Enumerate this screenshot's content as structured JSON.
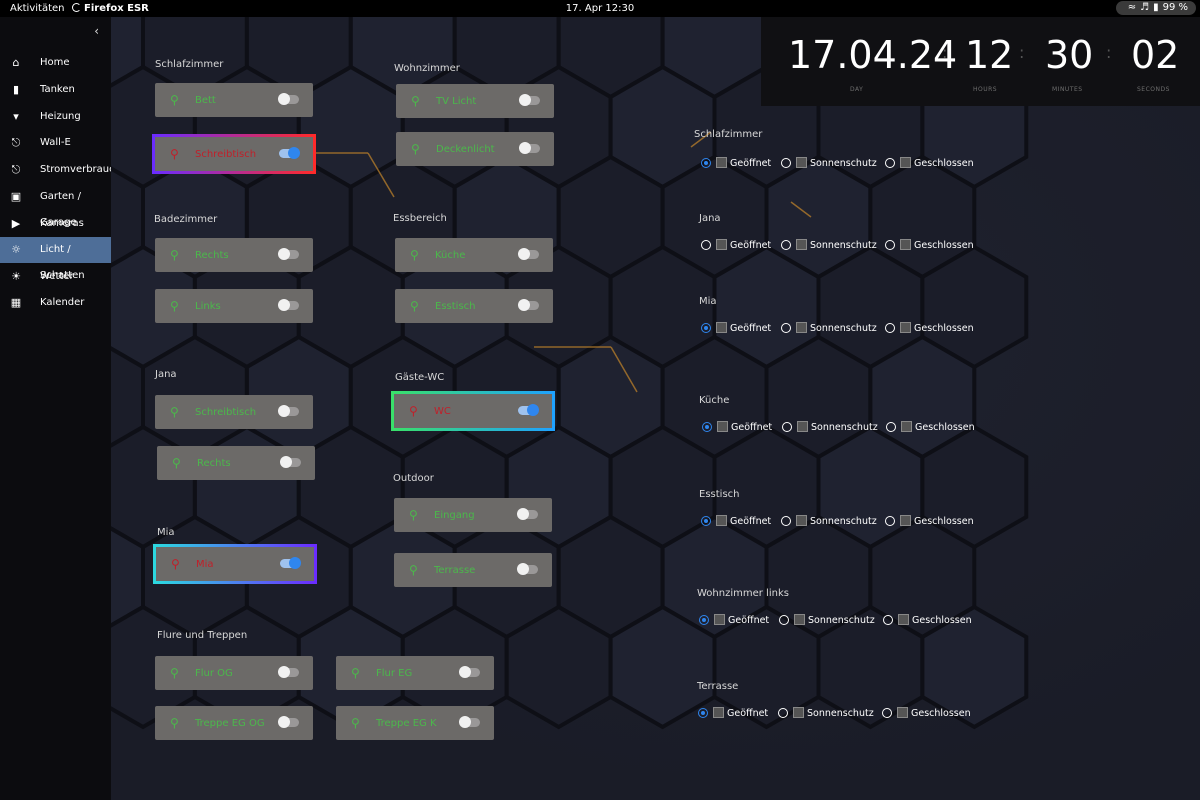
{
  "topbar": {
    "activities": "Aktivitäten",
    "app": "Firefox ESR",
    "datetime": "17. Apr  12:30",
    "battery": "99 %"
  },
  "sidebar": {
    "collapse_icon": "chevron-left-icon",
    "items": [
      {
        "label": "Home",
        "icon": "home-icon"
      },
      {
        "label": "Tanken",
        "icon": "fuel-icon"
      },
      {
        "label": "Heizung",
        "icon": "thermometer-icon"
      },
      {
        "label": "Wall-E",
        "icon": "plug-icon"
      },
      {
        "label": "Stromverbrauch",
        "icon": "power-plug-icon"
      },
      {
        "label": "Garten / Garage",
        "icon": "garage-icon"
      },
      {
        "label": "Kameras",
        "icon": "camera-icon"
      },
      {
        "label": "Licht / Schatten",
        "icon": "lamp-icon"
      },
      {
        "label": "Wetter",
        "icon": "sun-icon"
      },
      {
        "label": "Kalender",
        "icon": "calendar-icon"
      }
    ]
  },
  "clock": {
    "date": "17.04.24",
    "hours": "12",
    "minutes": "30",
    "seconds": "02",
    "labels": {
      "day": "DAY",
      "hours": "HOURS",
      "minutes": "MINUTES",
      "seconds": "SECONDS"
    }
  },
  "lights": {
    "schlafzimmer": {
      "title": "Schlafzimmer",
      "items": [
        {
          "label": "Bett",
          "on": false
        },
        {
          "label": "Schreibtisch",
          "on": true
        }
      ]
    },
    "wohnzimmer": {
      "title": "Wohnzimmer",
      "items": [
        {
          "label": "TV Licht",
          "on": false
        },
        {
          "label": "Deckenlicht",
          "on": false
        }
      ]
    },
    "badezimmer": {
      "title": "Badezimmer",
      "items": [
        {
          "label": "Rechts",
          "on": false
        },
        {
          "label": "Links",
          "on": false
        }
      ]
    },
    "essbereich": {
      "title": "Essbereich",
      "items": [
        {
          "label": "Küche",
          "on": false
        },
        {
          "label": "Esstisch",
          "on": false
        }
      ]
    },
    "jana": {
      "title": "Jana",
      "items": [
        {
          "label": "Schreibtisch",
          "on": false
        },
        {
          "label": "Rechts",
          "on": false
        }
      ]
    },
    "gaeste_wc": {
      "title": "Gäste-WC",
      "items": [
        {
          "label": "WC",
          "on": true
        }
      ]
    },
    "outdoor": {
      "title": "Outdoor",
      "items": [
        {
          "label": "Eingang",
          "on": false
        },
        {
          "label": "Terrasse",
          "on": false
        }
      ]
    },
    "mia": {
      "title": "Mia",
      "items": [
        {
          "label": "Mia",
          "on": true
        }
      ]
    },
    "flure": {
      "title": "Flure und Treppen",
      "items": [
        {
          "label": "Flur OG",
          "on": false
        },
        {
          "label": "Flur EG",
          "on": false
        },
        {
          "label": "Treppe EG OG",
          "on": false
        },
        {
          "label": "Treppe EG K",
          "on": false
        }
      ]
    }
  },
  "shades": {
    "options": [
      "Geöffnet",
      "Sonnenschutz",
      "Geschlossen"
    ],
    "rooms": [
      {
        "title": "Schlafzimmer",
        "selected": "Geöffnet"
      },
      {
        "title": "Jana",
        "selected": ""
      },
      {
        "title": "Mia",
        "selected": "Geöffnet"
      },
      {
        "title": "Küche",
        "selected": "Geöffnet"
      },
      {
        "title": "Esstisch",
        "selected": "Geöffnet"
      },
      {
        "title": "Wohnzimmer links",
        "selected": "Geöffnet"
      },
      {
        "title": "Terrasse",
        "selected": "Geöffnet"
      }
    ]
  },
  "colors": {
    "accent": "#2f86ee",
    "card": "#6c6a68",
    "label_off": "#4bb84b",
    "label_on": "#c0202a",
    "active_nav": "#4e6e98"
  }
}
